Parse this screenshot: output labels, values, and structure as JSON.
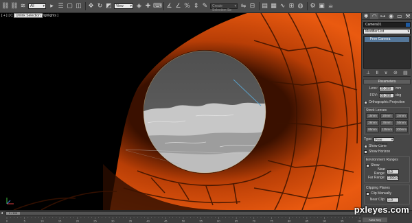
{
  "toolbar": {
    "selection_filter": "All",
    "ref_coord": "View",
    "named_selection_placeholder": "Create Selection Se",
    "icons": [
      "link-icon",
      "unlink-icon",
      "bind-spacewarp-icon",
      "select-object-icon",
      "select-by-name-icon",
      "select-region-icon",
      "window-crossing-icon",
      "move-icon",
      "rotate-icon",
      "scale-icon",
      "pivot-icon",
      "select-manipulate-icon",
      "keyboard-shortcut-icon",
      "snap-toggle-icon",
      "angle-snap-icon",
      "percent-snap-icon",
      "spinner-snap-icon",
      "edit-named-selection-icon",
      "mirror-icon",
      "align-icon",
      "layer-manager-icon",
      "graphite-tools-icon",
      "curve-editor-icon",
      "schematic-view-icon",
      "material-editor-icon",
      "render-setup-icon",
      "rendered-frame-icon",
      "render-icon"
    ]
  },
  "viewport": {
    "label_parts": [
      "[ + ]",
      "[ C",
      "]",
      "[ ",
      "Highlights ]"
    ],
    "tooltip": "Unlink Selection",
    "label_tail": "Highlights ]"
  },
  "command_panel": {
    "tabs": [
      "create-icon",
      "modify-icon",
      "hierarchy-icon",
      "motion-icon",
      "display-icon",
      "utilities-icon"
    ],
    "object_name": "Camera01",
    "object_color": "#1e5aa0",
    "modifier_list": "Modifier List",
    "stack_item": "Free Camera",
    "rollout_title": "Parameters",
    "lens_label": "Lens:",
    "lens_value": "20.309",
    "lens_unit": "mm",
    "fov_label": "FOV:",
    "fov_value": "89.308",
    "fov_unit": "deg",
    "ortho_label": "Orthographic Projection",
    "stock_lenses_title": "Stock Lenses",
    "stock_lenses": [
      "15mm",
      "20mm",
      "24mm",
      "28mm",
      "35mm",
      "50mm",
      "85mm",
      "135mm",
      "200mm"
    ],
    "type_label": "Type:",
    "type_value": "Free Camera",
    "show_cone": "Show Cone",
    "show_horizon": "Show Horizon",
    "env_ranges_title": "Environment Ranges",
    "env_show": "Show",
    "near_range_label": "Near Range:",
    "near_range_value": "0.0",
    "far_range_label": "Far Range:",
    "far_range_value": "1000.0",
    "clipping_title": "Clipping Planes",
    "clip_manually": "Clip Manually",
    "near_clip_label": "Near Clip:",
    "near_clip_value": "1.0"
  },
  "timeline": {
    "slider_label": "0 / 100",
    "ruler_ticks": [
      "0",
      "5",
      "10",
      "15",
      "20",
      "25",
      "30",
      "35",
      "40",
      "45",
      "50",
      "55",
      "60",
      "65",
      "70",
      "75",
      "80",
      "85",
      "90",
      "95",
      "100"
    ],
    "auto_key": "Auto Key Selected"
  },
  "watermark": "pxleyes.com",
  "colors": {
    "tunnel_orange": "#e8590f",
    "tunnel_dark": "#1a0800",
    "sky_gray": "#5d5d5d",
    "ui_dark": "#474747"
  }
}
